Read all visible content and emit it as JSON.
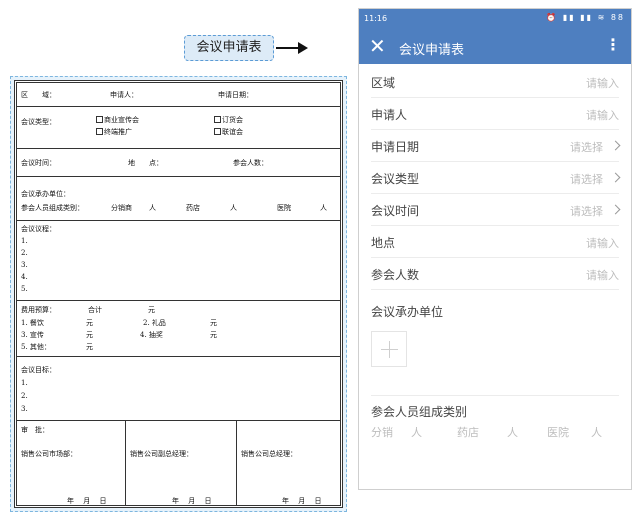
{
  "label": {
    "text": "会议申请表"
  },
  "paper": {
    "row1": {
      "region": "区　　域：",
      "applicant": "申请人：",
      "apply_date": "申请日期："
    },
    "row2": {
      "type_label": "会议类型：",
      "opt1": "商业宣传会",
      "opt2": "订货会",
      "opt3": "终端推广",
      "opt4": "联谊会"
    },
    "row3": {
      "time": "会议时间：",
      "place": "地　　点：",
      "count": "参会人数："
    },
    "row4": {
      "org": "会议承办单位：",
      "composition": "参会人员组成类别：",
      "dist": "分销商",
      "person1": "人",
      "pharmacy": "药店",
      "person2": "人",
      "hospital": "医院",
      "person3": "人"
    },
    "agenda": {
      "title": "会议议程：",
      "items": [
        "1.",
        "2.",
        "3.",
        "4.",
        "5."
      ]
    },
    "budget": {
      "title": "费用预算：",
      "total": "合计",
      "yuan": "元",
      "item1": "1. 餐饮",
      "yuan1": "元",
      "item2": "2. 礼品",
      "yuan2": "元",
      "item3": "3. 宣传",
      "yuan3": "元",
      "item4": "4. 抽奖",
      "yuan4": "元",
      "item5": "5. 其他：",
      "yuan5": "元"
    },
    "goal": {
      "title": "会议目标：",
      "items": [
        "1.",
        "2.",
        "3."
      ]
    },
    "approve": {
      "title": "审　批：",
      "c1": "销售公司市场部：",
      "c2": "销售公司副总经理：",
      "c3": "销售公司总经理：",
      "date": "年　 月　 日"
    }
  },
  "phone": {
    "status": {
      "time": "11:16",
      "icons": "⏰ ▮▮ ▮▮ ≋ 88"
    },
    "appbar": {
      "title": "会议申请表"
    },
    "fields": [
      {
        "label": "区域",
        "value": "请输入"
      },
      {
        "label": "申请人",
        "value": "请输入"
      },
      {
        "label": "申请日期",
        "value": "请选择"
      },
      {
        "label": "会议类型",
        "value": "请选择"
      },
      {
        "label": "会议时间",
        "value": "请选择"
      },
      {
        "label": "地点",
        "value": "请输入"
      },
      {
        "label": "参会人数",
        "value": "请输入"
      }
    ],
    "org_label": "会议承办单位",
    "composition_label": "参会人员组成类别",
    "categories": [
      "分销",
      "人",
      "药店",
      "人",
      "医院",
      "人"
    ]
  },
  "colors": {
    "appbar": "#4e7fc0",
    "placeholder": "#bdbdbd",
    "label_bg": "#ddebf7"
  },
  "icons": [
    "close-icon",
    "more-icon",
    "chevron-right-icon",
    "plus-icon",
    "arrow-right-icon"
  ]
}
